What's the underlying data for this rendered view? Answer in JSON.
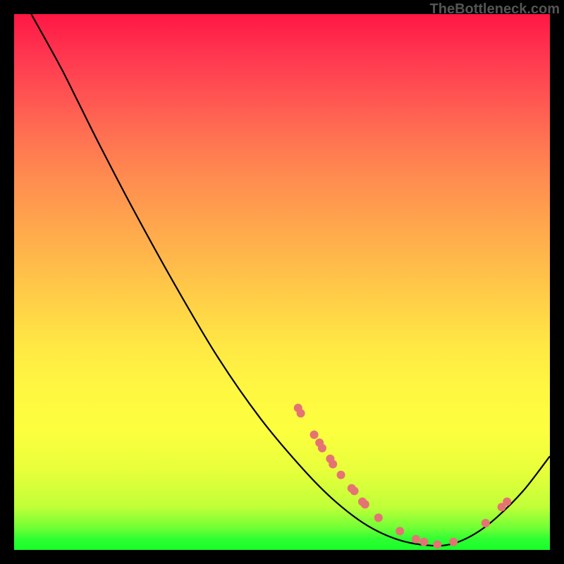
{
  "watermark": "TheBottleneck.com",
  "chart_data": {
    "type": "line",
    "title": "",
    "xlabel": "",
    "ylabel": "",
    "xlim": [
      0,
      100
    ],
    "ylim": [
      0,
      100
    ],
    "grid": false,
    "legend": false,
    "curve": {
      "name": "bottleneck-curve",
      "color": "#000000",
      "points": [
        {
          "x": 3.2,
          "y": 100
        },
        {
          "x": 6,
          "y": 95
        },
        {
          "x": 9,
          "y": 89.5
        },
        {
          "x": 12,
          "y": 83.5
        },
        {
          "x": 16,
          "y": 75.5
        },
        {
          "x": 22,
          "y": 64
        },
        {
          "x": 30,
          "y": 49.5
        },
        {
          "x": 38,
          "y": 36
        },
        {
          "x": 46,
          "y": 24.5
        },
        {
          "x": 54,
          "y": 15
        },
        {
          "x": 60,
          "y": 9
        },
        {
          "x": 66,
          "y": 4.5
        },
        {
          "x": 72,
          "y": 1.8
        },
        {
          "x": 78,
          "y": 0.8
        },
        {
          "x": 82,
          "y": 1.2
        },
        {
          "x": 86,
          "y": 3
        },
        {
          "x": 90,
          "y": 6
        },
        {
          "x": 95,
          "y": 11
        },
        {
          "x": 100,
          "y": 17.5
        }
      ]
    },
    "markers": {
      "name": "data-points",
      "color": "#e57373",
      "radius": 6,
      "points": [
        {
          "x": 53,
          "y": 26.5
        },
        {
          "x": 53.5,
          "y": 25.5
        },
        {
          "x": 56,
          "y": 21.5
        },
        {
          "x": 57,
          "y": 20
        },
        {
          "x": 57.5,
          "y": 19
        },
        {
          "x": 59,
          "y": 17
        },
        {
          "x": 59.5,
          "y": 16
        },
        {
          "x": 61,
          "y": 14
        },
        {
          "x": 63,
          "y": 11.5
        },
        {
          "x": 63.5,
          "y": 11
        },
        {
          "x": 65,
          "y": 9
        },
        {
          "x": 65.5,
          "y": 8.5
        },
        {
          "x": 68,
          "y": 6
        },
        {
          "x": 72,
          "y": 3.5
        },
        {
          "x": 75,
          "y": 2
        },
        {
          "x": 76.5,
          "y": 1.5
        },
        {
          "x": 79,
          "y": 1
        },
        {
          "x": 82,
          "y": 1.5
        },
        {
          "x": 88,
          "y": 5
        },
        {
          "x": 91,
          "y": 8
        },
        {
          "x": 92,
          "y": 9
        }
      ]
    }
  }
}
